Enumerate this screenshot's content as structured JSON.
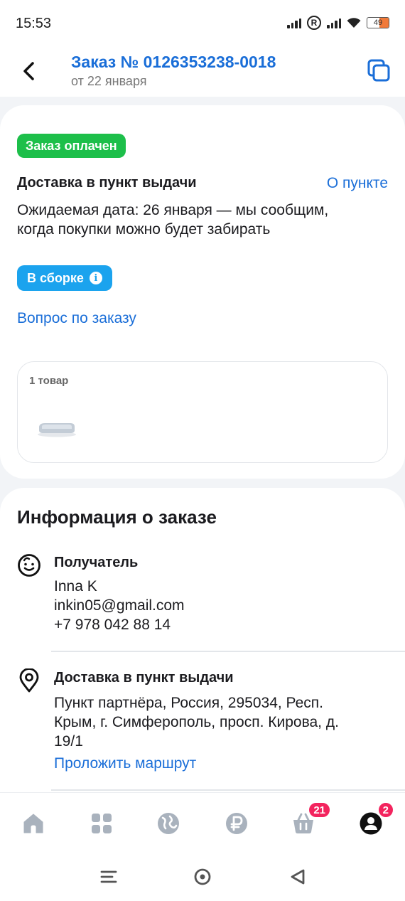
{
  "status_bar": {
    "time": "15:53",
    "r_label": "R",
    "battery": "49",
    "battery_level": 0.49
  },
  "header": {
    "title": "Заказ № 0126353238-0018",
    "subtitle": "от 22 января"
  },
  "order": {
    "paid_badge": "Заказ оплачен",
    "delivery_title": "Доставка в пункт выдачи",
    "about_point_link": "О пункте",
    "expected_text": "Ожидаемая дата: 26 января — мы сообщим, когда покупки можно будет забирать",
    "status_pill": "В сборке",
    "info_glyph": "i",
    "question_link": "Вопрос по заказу",
    "items_count": "1 товар"
  },
  "info": {
    "title": "Информация о заказе",
    "recipient": {
      "title": "Получатель",
      "name": "Inna K",
      "email": "inkin05@gmail.com",
      "phone": "+7 978 042 88 14"
    },
    "delivery": {
      "title": "Доставка в пункт выдачи",
      "address_line1": "Пункт партнёра, Россия, 295034, Респ.",
      "address_line2": "Крым, г. Симферополь, просп. Кирова, д.",
      "address_line3": "19/1",
      "route_link": "Проложить маршрут"
    }
  },
  "bottom_nav": {
    "cart_badge": "21",
    "profile_badge": "2",
    "accent_color": "#f3245e",
    "inactive_color": "#a9b2bd"
  },
  "colors": {
    "link": "#1a6ed8",
    "paid": "#1dbf4a",
    "status": "#1ba3ee"
  }
}
